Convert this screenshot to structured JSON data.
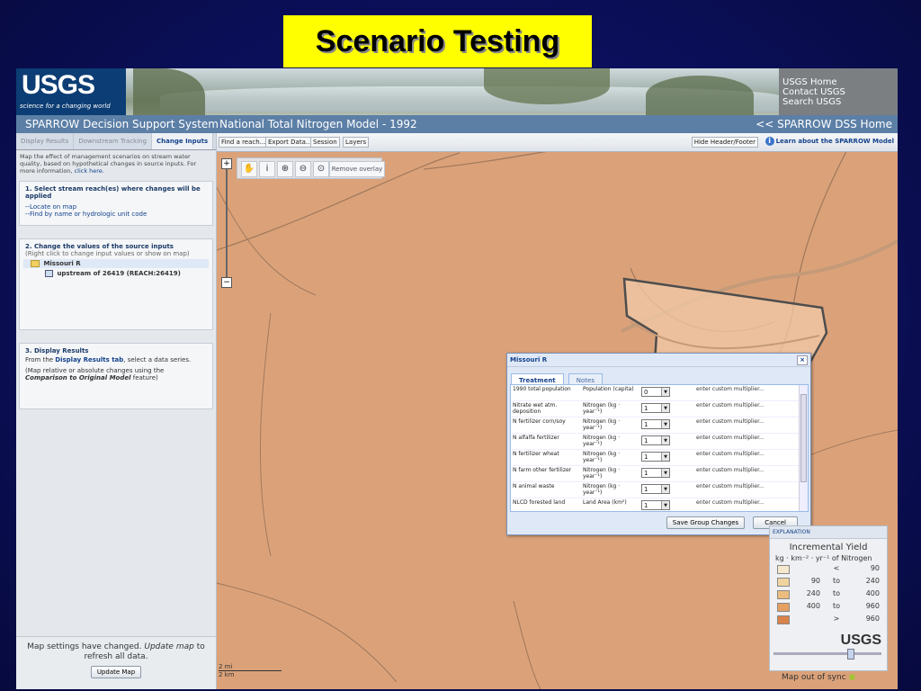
{
  "slide": {
    "title": "Scenario Testing"
  },
  "header": {
    "logo": "USGS",
    "logo_tagline": "science for a changing world",
    "links": [
      "USGS Home",
      "Contact USGS",
      "Search USGS"
    ],
    "app_title": "SPARROW Decision Support System",
    "model_title": "National Total Nitrogen Model - 1992",
    "home_link": "<< SPARROW DSS Home"
  },
  "left": {
    "tabs": [
      "Display Results",
      "Downstream Tracking",
      "Change Inputs"
    ],
    "intro": "Map the effect of management scenarios on stream water quality, based on hypothetical changes in source inputs. For more information,",
    "intro_link": "click here.",
    "step1": {
      "heading": "1. Select stream reach(es) where changes will be applied",
      "link1": "--Locate on map",
      "link2": "--Find by name or hydrologic unit code"
    },
    "step2": {
      "heading": "2. Change the values of the source inputs",
      "sub": "(Right click to change input values or show on map)",
      "node": "Missouri R",
      "child": "upstream of 26419 (REACH:26419)"
    },
    "step3": {
      "heading": "3. Display Results",
      "line1a": "From the ",
      "line1b": "Display Results tab",
      "line1c": ", select a data series.",
      "line2a": "(Map relative or absolute changes using the ",
      "line2b": "Comparison to Original Model",
      "line2c": " feature)"
    },
    "footer_msg_a": "Map settings have changed.",
    "footer_msg_b": "Update map",
    "footer_msg_c": "to refresh all data.",
    "update_button": "Update Map"
  },
  "maptoolbar": {
    "items": [
      "Find a reach...",
      "Export Data...",
      "Session",
      "Layers"
    ],
    "hide": "Hide Header/Footer",
    "learn": "Learn about the SPARROW Model"
  },
  "maptools": {
    "remove": "Remove overlay"
  },
  "dialog": {
    "title": "Missouri R",
    "tabs": [
      "Treatment",
      "Notes"
    ],
    "rows": [
      {
        "source": "1990 total population",
        "units": "Population (capita)",
        "value": "0",
        "custom": "enter custom multiplier..."
      },
      {
        "source": "Nitrate wet atm. deposition",
        "units": "Nitrogen (kg · year⁻¹)",
        "value": "1",
        "custom": "enter custom multiplier..."
      },
      {
        "source": "N fertilizer corn/soy",
        "units": "Nitrogen (kg · year⁻¹)",
        "value": "1",
        "custom": "enter custom multiplier..."
      },
      {
        "source": "N alfalfa fertilizer",
        "units": "Nitrogen (kg · year⁻¹)",
        "value": "1",
        "custom": "enter custom multiplier..."
      },
      {
        "source": "N fertilizer wheat",
        "units": "Nitrogen (kg · year⁻¹)",
        "value": "1",
        "custom": "enter custom multiplier..."
      },
      {
        "source": "N farm other fertilizer",
        "units": "Nitrogen (kg · year⁻¹)",
        "value": "1",
        "custom": "enter custom multiplier..."
      },
      {
        "source": "N animal waste",
        "units": "Nitrogen (kg · year⁻¹)",
        "value": "1",
        "custom": "enter custom multiplier..."
      },
      {
        "source": "NLCD forested land",
        "units": "Land Area (km²)",
        "value": "1",
        "custom": "enter custom multiplier..."
      }
    ],
    "save_button": "Save Group Changes",
    "cancel_button": "Cancel"
  },
  "legend": {
    "header": "EXPLANATION",
    "title": "Incremental Yield",
    "units": "kg · km⁻² · yr⁻¹ of Nitrogen",
    "classes": [
      {
        "a": "",
        "b": "<",
        "c": "90",
        "color": "#f6e8cc"
      },
      {
        "a": "90",
        "b": "to",
        "c": "240",
        "color": "#f0d4a0"
      },
      {
        "a": "240",
        "b": "to",
        "c": "400",
        "color": "#ecbd7e"
      },
      {
        "a": "400",
        "b": "to",
        "c": "960",
        "color": "#e5a062"
      },
      {
        "a": "",
        "b": ">",
        "c": "960",
        "color": "#d9824a"
      }
    ],
    "logo": "USGS",
    "status": "Map out of sync"
  },
  "scale": {
    "mi": "2 mi",
    "km": "2 km"
  }
}
